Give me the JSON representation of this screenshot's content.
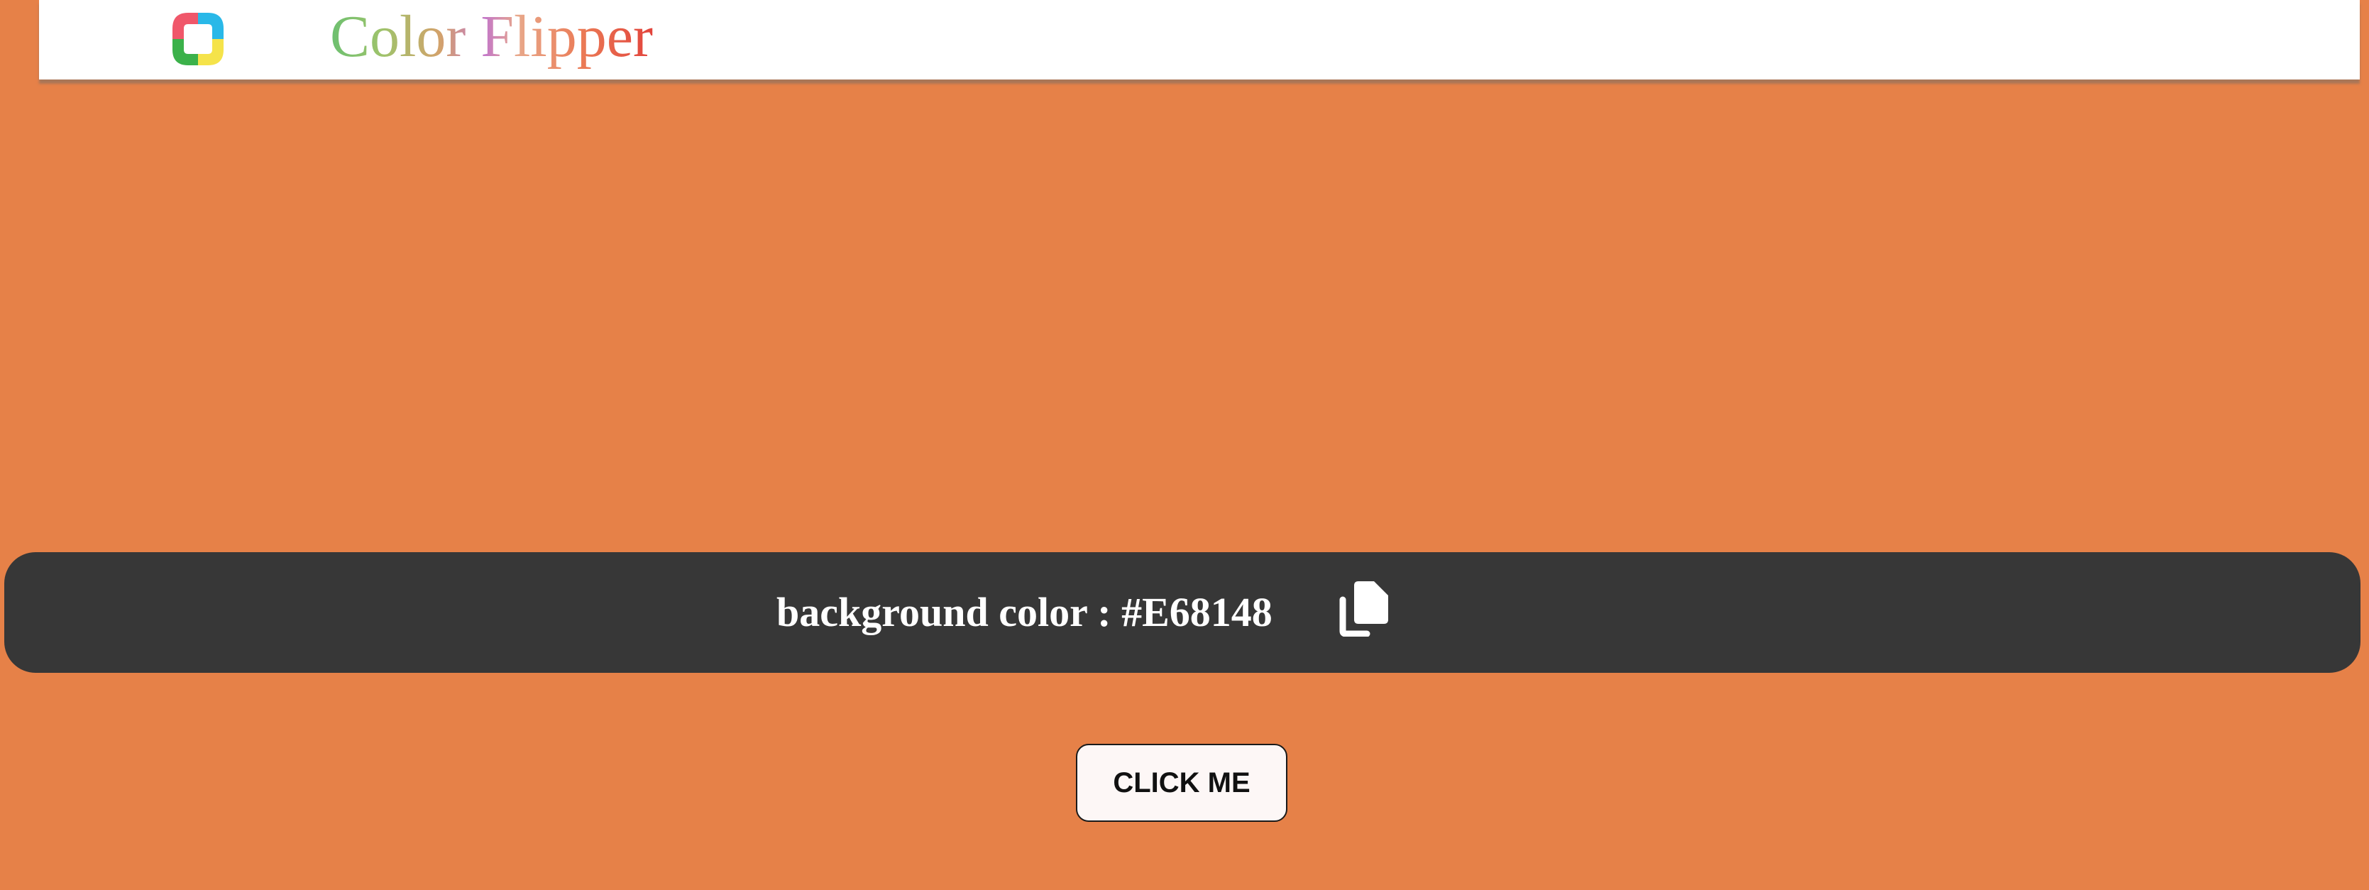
{
  "app": {
    "title": "Color Flipper",
    "logo_icon": "color-flipper-logo-icon"
  },
  "colors": {
    "background": "#E68148",
    "bar": "#373737",
    "navbar": "#ffffff"
  },
  "display": {
    "label": "background color : #E68148",
    "copy_icon": "copy-icon"
  },
  "action": {
    "button_label": "CLICK ME"
  }
}
